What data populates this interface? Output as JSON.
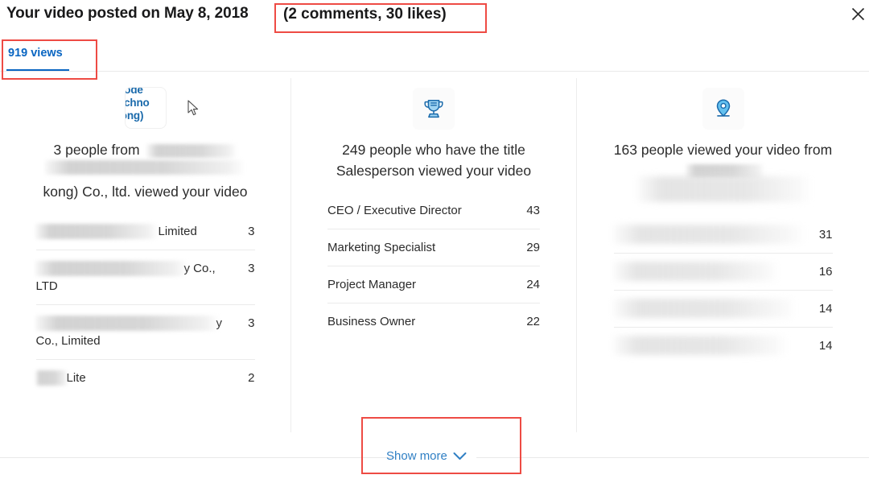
{
  "header": {
    "title": "Your video posted on May 8, 2018",
    "engagement": "(2 comments, 30 likes)",
    "close_icon": "close-icon"
  },
  "tabs": [
    {
      "label": "919 views",
      "active": true
    }
  ],
  "columns": {
    "companies": {
      "icon": "company-logo",
      "logo_text": "mode techno kong)",
      "headline_parts": {
        "before": "3 people from",
        "redacted": "[redacted company name]",
        "after": "kong) Co., ltd. viewed your video"
      },
      "headline_full": "3 people from [redacted] kong) Co., ltd. viewed your video",
      "rows": [
        {
          "label": "Limited",
          "redacted": true,
          "value": "3"
        },
        {
          "label": "y Co., LTD",
          "redacted": true,
          "value": "3"
        },
        {
          "label": "y Co., Limited",
          "redacted": true,
          "value": "3"
        },
        {
          "label": "Lite",
          "redacted": true,
          "value": "2"
        }
      ]
    },
    "titles": {
      "icon": "trophy-icon",
      "headline": "249 people who have the title Salesperson viewed your video",
      "rows": [
        {
          "label": "CEO / Executive Director",
          "redacted": false,
          "value": "43"
        },
        {
          "label": "Marketing Specialist",
          "redacted": false,
          "value": "29"
        },
        {
          "label": "Project Manager",
          "redacted": false,
          "value": "24"
        },
        {
          "label": "Business Owner",
          "redacted": false,
          "value": "22"
        }
      ]
    },
    "locations": {
      "icon": "location-pin-icon",
      "headline_parts": {
        "before": "163 people viewed your video from",
        "redacted": "[redacted location name]"
      },
      "headline_full": "163 people viewed your video from [redacted]",
      "rows": [
        {
          "label": "[redacted]",
          "redacted": true,
          "value": "31"
        },
        {
          "label": "[redacted]",
          "redacted": true,
          "value": "16"
        },
        {
          "label": "[redacted]",
          "redacted": true,
          "value": "14"
        },
        {
          "label": "[redacted]",
          "redacted": true,
          "value": "14"
        }
      ]
    }
  },
  "footer": {
    "show_more_label": "Show more",
    "chevron_icon": "chevron-down-icon"
  },
  "annotations": {
    "highlight_color": "#ee4b44",
    "boxes": [
      {
        "name": "engagement-highlight",
        "target": "(2 comments, 30 likes)"
      },
      {
        "name": "views-tab-highlight",
        "target": "919 views"
      },
      {
        "name": "show-more-highlight",
        "target": "Show more"
      }
    ]
  },
  "theme": {
    "link_color": "#0a66c2",
    "text_color": "#2b2b2b",
    "rule_color": "#e9e9e9"
  }
}
